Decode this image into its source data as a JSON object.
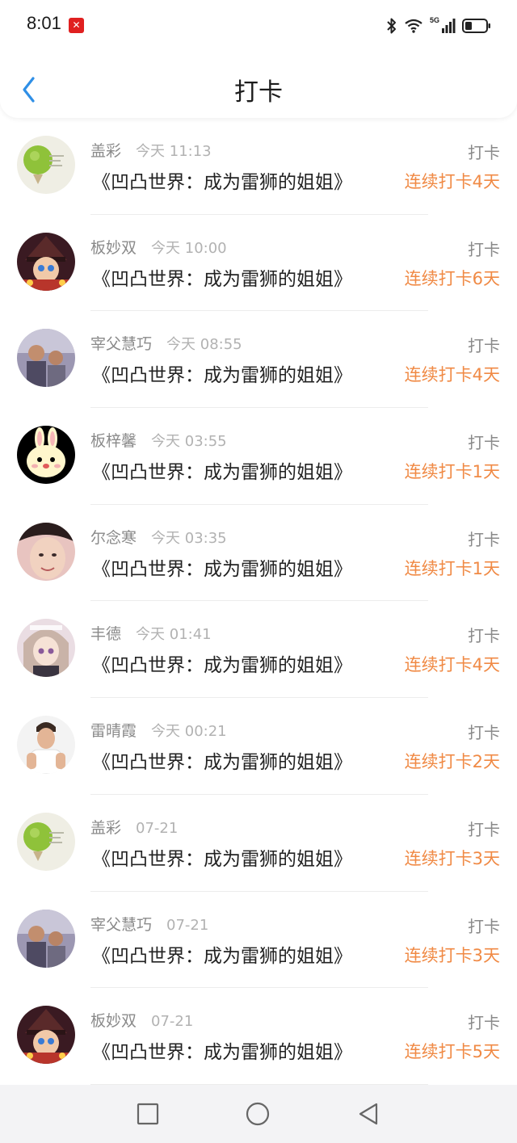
{
  "status_bar": {
    "time": "8:01",
    "badge": "✕"
  },
  "header": {
    "title": "打卡"
  },
  "items": [
    {
      "user": "盖彩",
      "time": "今天 11:13",
      "book": "《凹凸世界：成为雷狮的姐姐》",
      "action": "打卡",
      "streak": "连续打卡4天",
      "avatar": "lime"
    },
    {
      "user": "板妙双",
      "time": "今天 10:00",
      "book": "《凹凸世界：成为雷狮的姐姐》",
      "action": "打卡",
      "streak": "连续打卡6天",
      "avatar": "anime-hat"
    },
    {
      "user": "宰父慧巧",
      "time": "今天 08:55",
      "book": "《凹凸世界：成为雷狮的姐姐》",
      "action": "打卡",
      "streak": "连续打卡4天",
      "avatar": "photo-two"
    },
    {
      "user": "板梓馨",
      "time": "今天 03:55",
      "book": "《凹凸世界：成为雷狮的姐姐》",
      "action": "打卡",
      "streak": "连续打卡1天",
      "avatar": "bunny"
    },
    {
      "user": "尔念寒",
      "time": "今天 03:35",
      "book": "《凹凸世界：成为雷狮的姐姐》",
      "action": "打卡",
      "streak": "连续打卡1天",
      "avatar": "face"
    },
    {
      "user": "丰德",
      "time": "今天 01:41",
      "book": "《凹凸世界：成为雷狮的姐姐》",
      "action": "打卡",
      "streak": "连续打卡4天",
      "avatar": "anime-girl"
    },
    {
      "user": "雷晴霞",
      "time": "今天 00:21",
      "book": "《凹凸世界：成为雷狮的姐姐》",
      "action": "打卡",
      "streak": "连续打卡2天",
      "avatar": "man"
    },
    {
      "user": "盖彩",
      "time": "07-21",
      "book": "《凹凸世界：成为雷狮的姐姐》",
      "action": "打卡",
      "streak": "连续打卡3天",
      "avatar": "lime"
    },
    {
      "user": "宰父慧巧",
      "time": "07-21",
      "book": "《凹凸世界：成为雷狮的姐姐》",
      "action": "打卡",
      "streak": "连续打卡3天",
      "avatar": "photo-two"
    },
    {
      "user": "板妙双",
      "time": "07-21",
      "book": "《凹凸世界：成为雷狮的姐姐》",
      "action": "打卡",
      "streak": "连续打卡5天",
      "avatar": "anime-hat"
    }
  ],
  "colors": {
    "accent": "#f08a45",
    "back_arrow": "#2f8fe6",
    "secondary_text": "#8a8a8a"
  },
  "nav_bar": {
    "buttons": [
      "recent-apps",
      "home",
      "back"
    ]
  }
}
